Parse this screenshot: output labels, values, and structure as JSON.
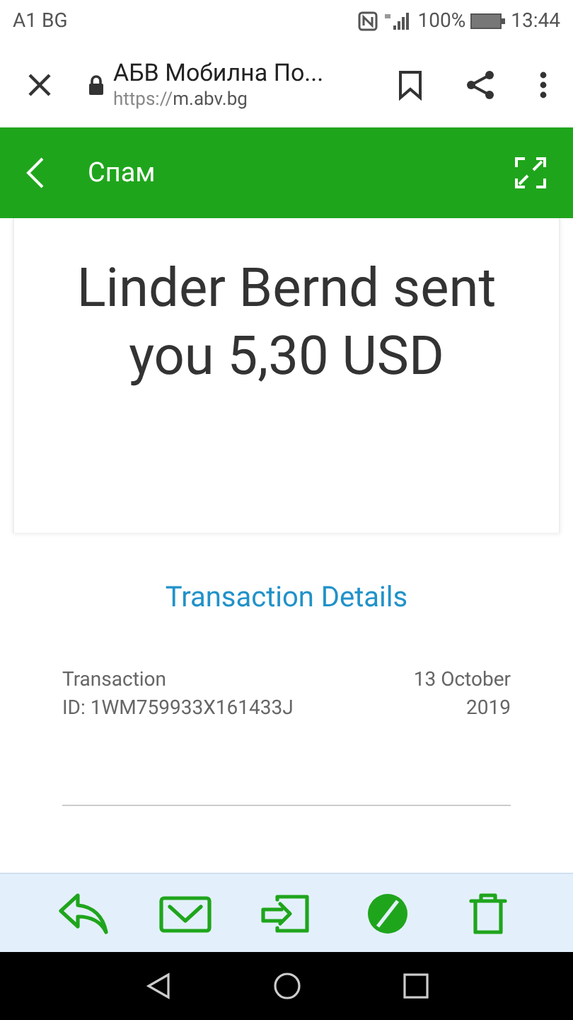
{
  "status_bar": {
    "carrier": "A1 BG",
    "battery": "100%",
    "time": "13:44"
  },
  "browser": {
    "title": "АБВ Мобилна По...",
    "url_scheme": "https://",
    "url_host": "m.abv.bg"
  },
  "header": {
    "title": "Спам"
  },
  "message": {
    "headline": "Linder Bernd sent you 5,30 USD",
    "link": "Transaction Details",
    "transaction_label": "Transaction",
    "transaction_id": "ID: 1WM759933X161433J",
    "date": "13 October 2019"
  },
  "toolbar": [
    {
      "kind": "reply"
    },
    {
      "kind": "mail"
    },
    {
      "kind": "move"
    },
    {
      "kind": "notspam"
    },
    {
      "kind": "delete"
    }
  ]
}
